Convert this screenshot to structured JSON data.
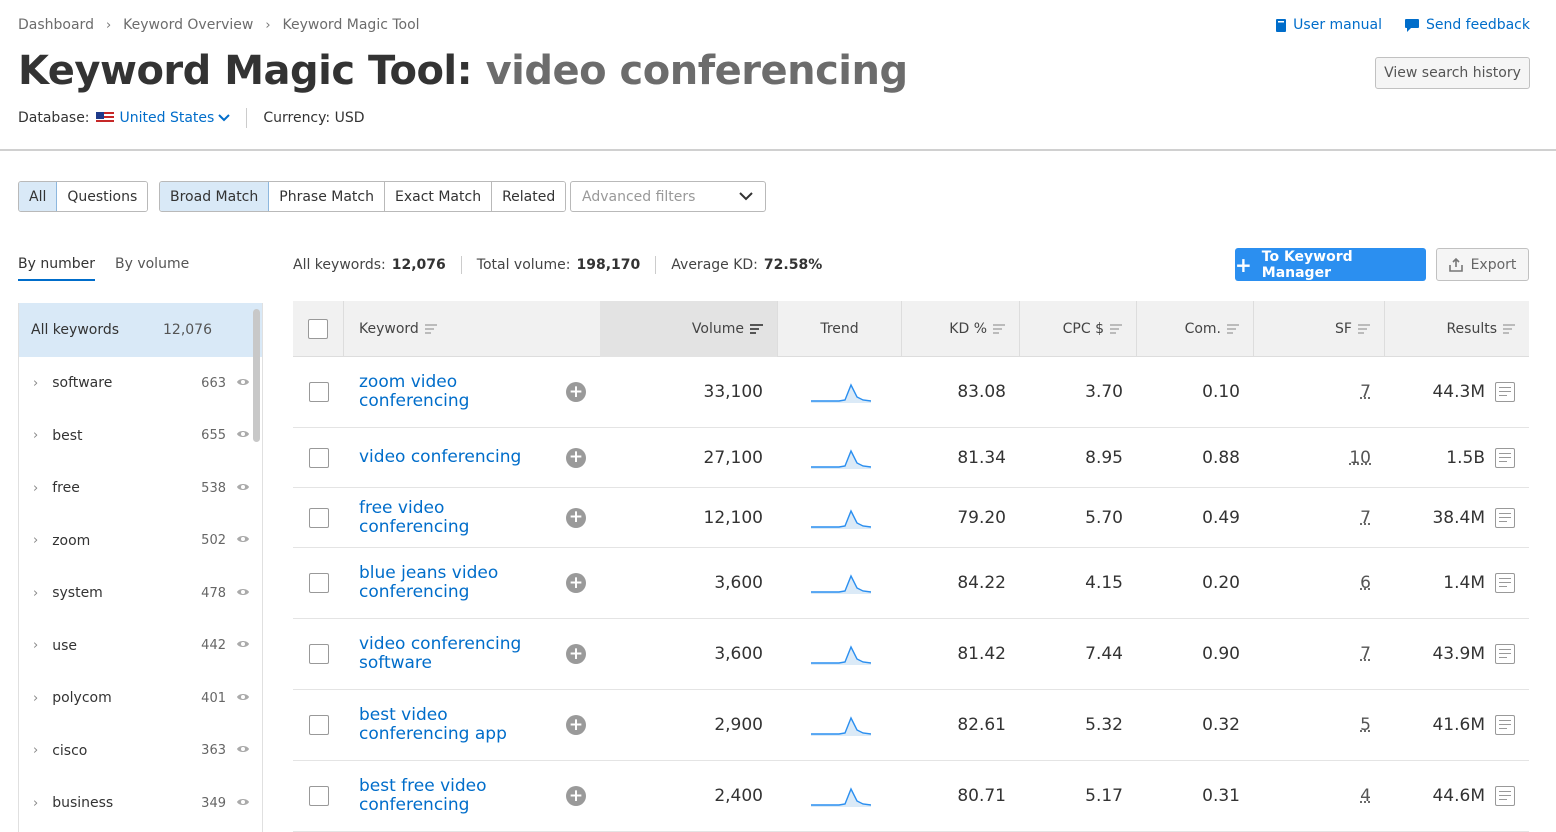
{
  "breadcrumb": [
    "Dashboard",
    "Keyword Overview",
    "Keyword Magic Tool"
  ],
  "header": {
    "user_manual": "User manual",
    "send_feedback": "Send feedback",
    "title_prefix": "Keyword Magic Tool:",
    "title_query": "video conferencing",
    "view_history": "View search history",
    "database_label": "Database:",
    "database_value": "United States",
    "currency": "Currency: USD"
  },
  "filters": {
    "group1": [
      "All",
      "Questions"
    ],
    "group2": [
      "Broad Match",
      "Phrase Match",
      "Exact Match",
      "Related"
    ],
    "advanced": "Advanced filters"
  },
  "side_tabs": [
    "By number",
    "By volume"
  ],
  "sidebar": {
    "all_label": "All keywords",
    "all_count": "12,076",
    "items": [
      {
        "label": "software",
        "count": "663"
      },
      {
        "label": "best",
        "count": "655"
      },
      {
        "label": "free",
        "count": "538"
      },
      {
        "label": "zoom",
        "count": "502"
      },
      {
        "label": "system",
        "count": "478"
      },
      {
        "label": "use",
        "count": "442"
      },
      {
        "label": "polycom",
        "count": "401"
      },
      {
        "label": "cisco",
        "count": "363"
      },
      {
        "label": "business",
        "count": "349"
      }
    ]
  },
  "stats": {
    "all_keywords_label": "All keywords:",
    "all_keywords": "12,076",
    "total_volume_label": "Total volume:",
    "total_volume": "198,170",
    "avg_kd_label": "Average KD:",
    "avg_kd": "72.58%"
  },
  "actions": {
    "to_keyword_manager": "To Keyword Manager",
    "export": "Export"
  },
  "table": {
    "columns": [
      "Keyword",
      "Volume",
      "Trend",
      "KD %",
      "CPC $",
      "Com.",
      "SF",
      "Results"
    ],
    "rows": [
      {
        "keyword": "zoom video conferencing",
        "volume": "33,100",
        "kd": "83.08",
        "cpc": "3.70",
        "com": "0.10",
        "sf": "7",
        "results": "44.3M"
      },
      {
        "keyword": "video conferencing",
        "volume": "27,100",
        "kd": "81.34",
        "cpc": "8.95",
        "com": "0.88",
        "sf": "10",
        "results": "1.5B"
      },
      {
        "keyword": "free video conferencing",
        "volume": "12,100",
        "kd": "79.20",
        "cpc": "5.70",
        "com": "0.49",
        "sf": "7",
        "results": "38.4M"
      },
      {
        "keyword": "blue jeans video conferencing",
        "volume": "3,600",
        "kd": "84.22",
        "cpc": "4.15",
        "com": "0.20",
        "sf": "6",
        "results": "1.4M"
      },
      {
        "keyword": "video conferencing software",
        "volume": "3,600",
        "kd": "81.42",
        "cpc": "7.44",
        "com": "0.90",
        "sf": "7",
        "results": "43.9M"
      },
      {
        "keyword": "best video conferencing app",
        "volume": "2,900",
        "kd": "82.61",
        "cpc": "5.32",
        "com": "0.32",
        "sf": "5",
        "results": "41.6M"
      },
      {
        "keyword": "best free video conferencing",
        "volume": "2,400",
        "kd": "80.71",
        "cpc": "5.17",
        "com": "0.31",
        "sf": "4",
        "results": "44.6M"
      }
    ]
  },
  "colors": {
    "accent": "#006dca",
    "primary_button": "#2b8ff0",
    "selected_bg": "#d9e9f7"
  }
}
